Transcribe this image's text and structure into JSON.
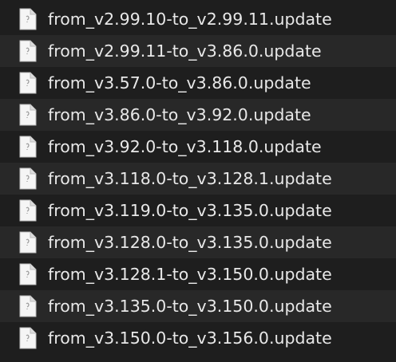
{
  "colors": {
    "background": "#1e1e1e",
    "row_alt": "#282828",
    "text": "#e8e8e8",
    "icon_fill": "#f5f5f5"
  },
  "file_icon": "generic-document-icon",
  "files": [
    {
      "name": "from_v2.99.10-to_v2.99.11.update"
    },
    {
      "name": "from_v2.99.11-to_v3.86.0.update"
    },
    {
      "name": "from_v3.57.0-to_v3.86.0.update"
    },
    {
      "name": "from_v3.86.0-to_v3.92.0.update"
    },
    {
      "name": "from_v3.92.0-to_v3.118.0.update"
    },
    {
      "name": "from_v3.118.0-to_v3.128.1.update"
    },
    {
      "name": "from_v3.119.0-to_v3.135.0.update"
    },
    {
      "name": "from_v3.128.0-to_v3.135.0.update"
    },
    {
      "name": "from_v3.128.1-to_v3.150.0.update"
    },
    {
      "name": "from_v3.135.0-to_v3.150.0.update"
    },
    {
      "name": "from_v3.150.0-to_v3.156.0.update"
    }
  ]
}
